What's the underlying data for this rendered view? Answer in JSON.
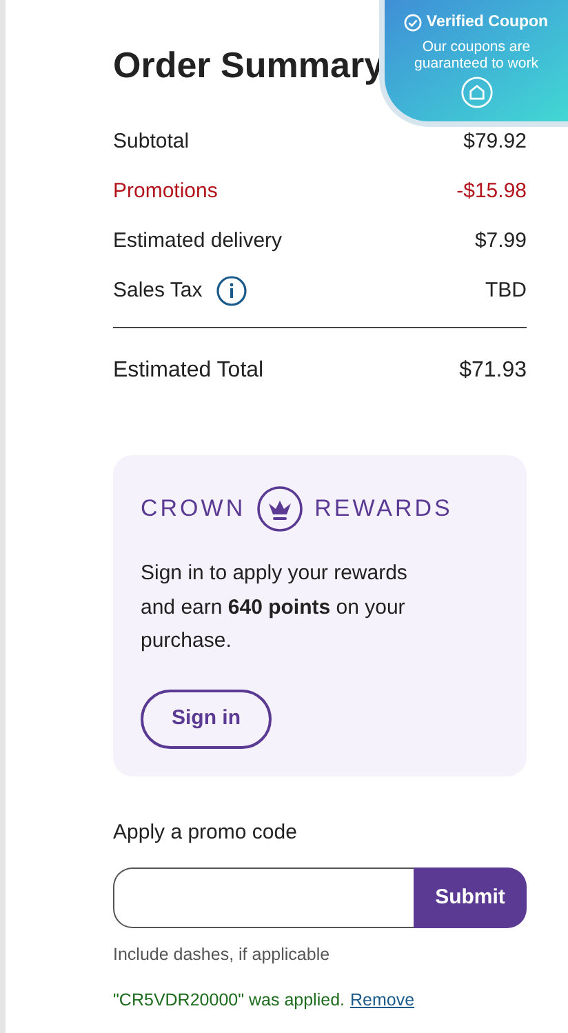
{
  "title": "Order Summary",
  "lines": [
    {
      "label": "Subtotal",
      "value": "$79.92",
      "kind": "plain"
    },
    {
      "label": "Promotions",
      "value": "-$15.98",
      "kind": "discount"
    },
    {
      "label": "Estimated delivery",
      "value": "$7.99",
      "kind": "plain"
    },
    {
      "label": "Sales Tax",
      "value": "TBD",
      "kind": "info"
    }
  ],
  "total": {
    "label": "Estimated Total",
    "value": "$71.93"
  },
  "rewards": {
    "brand_left": "CROWN",
    "brand_right": "REWARDS",
    "message": "Sign in to apply your rewards and earn **640 points** on your purchase.",
    "button": "Sign in"
  },
  "promo": {
    "label": "Apply a promo code",
    "button": "Submit",
    "hint": "Include dashes, if applicable",
    "applied": "\"CR5VDR20000\" was applied.",
    "remove": "Remove"
  },
  "coupon_badge": {
    "title": "Verified Coupon",
    "text": "Our coupons are guaranteed to work"
  }
}
